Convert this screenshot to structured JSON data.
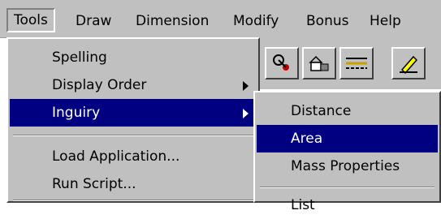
{
  "menubar": {
    "items": [
      "Tools",
      "Draw",
      "Dimension",
      "Modify",
      "Bonus",
      "Help"
    ]
  },
  "tools_menu": {
    "items": [
      {
        "label": "Spelling",
        "submenu": false
      },
      {
        "label": "Display Order",
        "submenu": true
      },
      {
        "label": "Inguiry",
        "submenu": true,
        "highlighted": true
      },
      {
        "label": "Load Application...",
        "submenu": false
      },
      {
        "label": "Run Script...",
        "submenu": false
      }
    ]
  },
  "inquiry_submenu": {
    "items": [
      {
        "label": "Distance"
      },
      {
        "label": "Area",
        "highlighted": true
      },
      {
        "label": "Mass Properties"
      },
      {
        "label": "List"
      }
    ]
  },
  "toolbar": {
    "icons": [
      "object-snap-icon",
      "block-icon",
      "linetype-icon",
      "pencil-icon"
    ]
  },
  "colors": {
    "menu_face": "#c0c0c0",
    "highlight": "#000080",
    "highlight_text": "#ffffff"
  }
}
